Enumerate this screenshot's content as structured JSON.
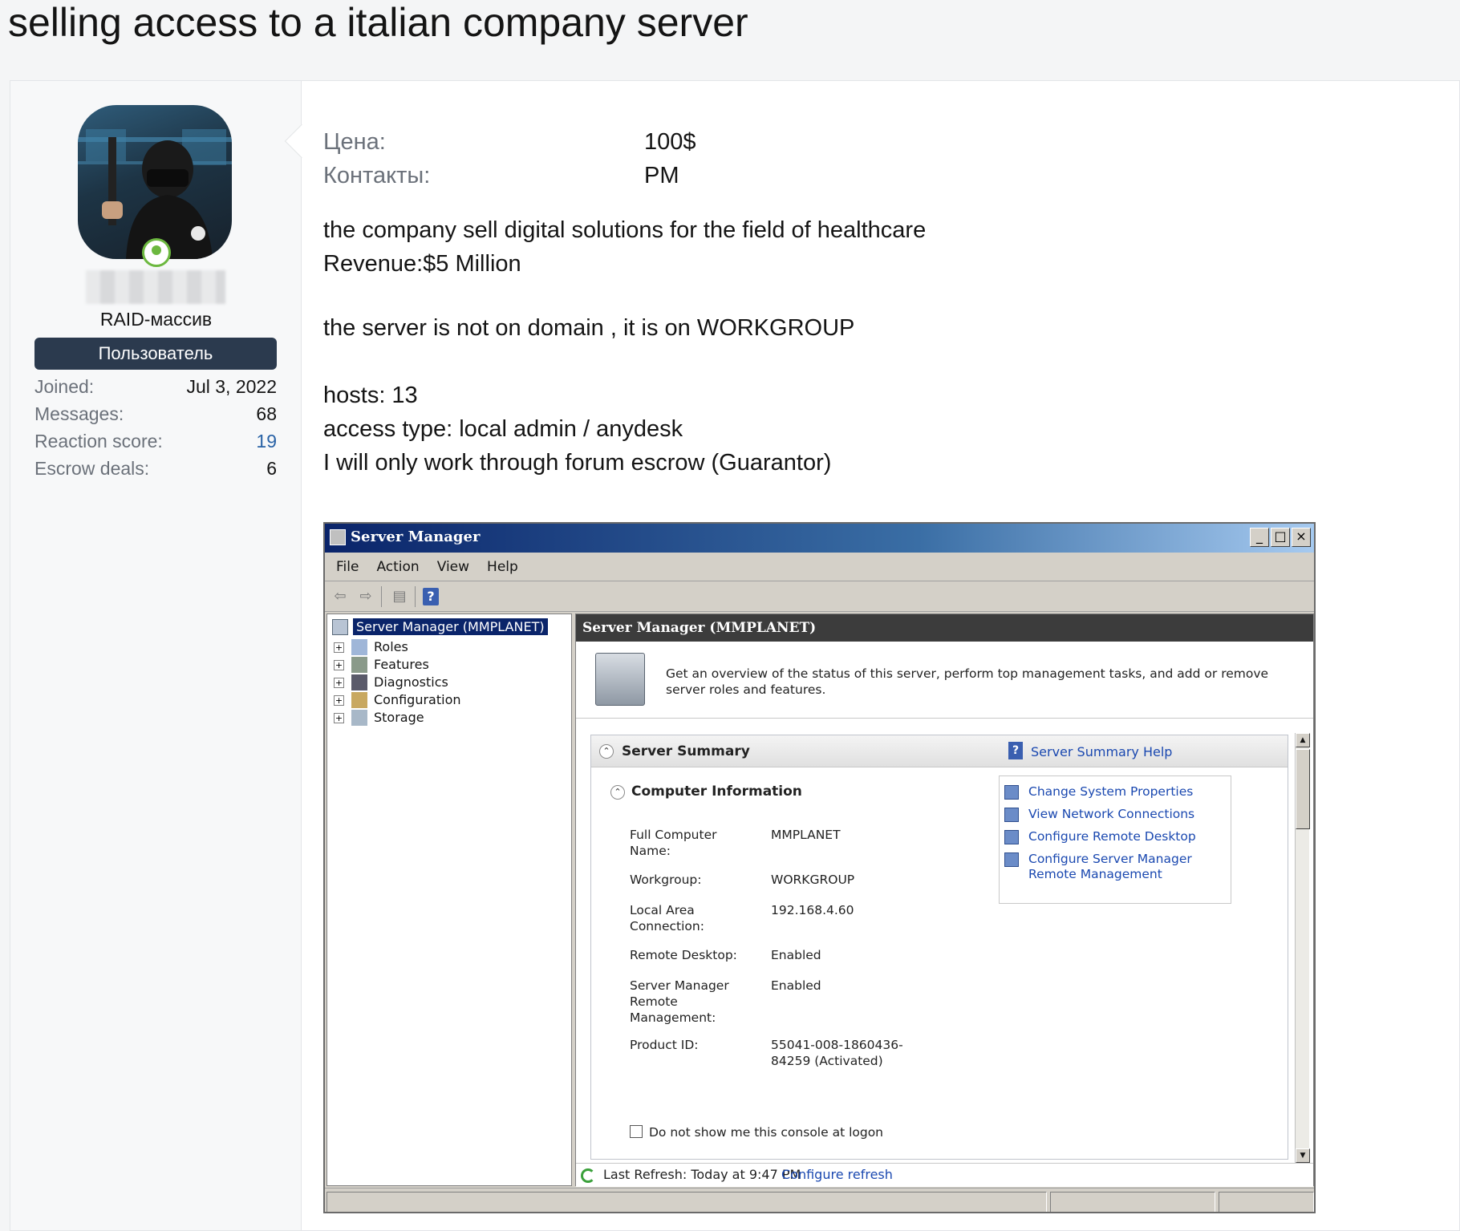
{
  "thread": {
    "title": "selling access to a italian company server"
  },
  "user": {
    "username": "RAID-массив",
    "role": "Пользователь",
    "stats": [
      {
        "label": "Joined:",
        "value": "Jul 3, 2022"
      },
      {
        "label": "Messages:",
        "value": "68"
      },
      {
        "label": "Reaction score:",
        "value": "19"
      },
      {
        "label": "Escrow deals:",
        "value": "6"
      }
    ]
  },
  "post": {
    "fields": [
      {
        "label": "Цена:",
        "value": "100$"
      },
      {
        "label": "Контакты:",
        "value": "PM"
      }
    ],
    "lines": [
      "the company sell digital solutions for the field of healthcare",
      "Revenue:$5 Million",
      "the server is not on domain , it is on WORKGROUP",
      "hosts: 13",
      "access type: local admin / anydesk",
      "I will only work through forum escrow (Guarantor)"
    ]
  },
  "server_manager": {
    "title": "Server Manager",
    "window_buttons": [
      "_",
      "□",
      "×"
    ],
    "menu": [
      "File",
      "Action",
      "View",
      "Help"
    ],
    "tree_root": "Server Manager (MMPLANET)",
    "tree_items": [
      "Roles",
      "Features",
      "Diagnostics",
      "Configuration",
      "Storage"
    ],
    "pane_title": "Server Manager (MMPLANET)",
    "overview": "Get an overview of the status of this server, perform top management tasks, and add or remove server roles and features.",
    "summary_title": "Server Summary",
    "summary_help": "Server Summary Help",
    "computer_info_title": "Computer Information",
    "info": [
      {
        "label": "Full Computer Name:",
        "value": "MMPLANET"
      },
      {
        "label": "Workgroup:",
        "value": "WORKGROUP"
      },
      {
        "label": "Local Area Connection:",
        "value": "192.168.4.60"
      },
      {
        "label": "Remote Desktop:",
        "value": "Enabled"
      },
      {
        "label": "Server Manager Remote Management:",
        "value": "Enabled"
      },
      {
        "label": "Product ID:",
        "value": "55041-008-1860436-84259 (Activated)"
      }
    ],
    "tasks": [
      "Change System Properties",
      "View Network Connections",
      "Configure Remote Desktop",
      "Configure Server Manager Remote Management"
    ],
    "logon_checkbox": "Do not show me this console at logon",
    "last_refresh": "Last Refresh: Today at 9:47 PM",
    "configure_refresh": "Configure refresh"
  },
  "colors": {
    "role_badge": "#2b3a4e",
    "link": "#2a63a6",
    "online": "#6cb83f",
    "titlebar": "#0a246a"
  }
}
